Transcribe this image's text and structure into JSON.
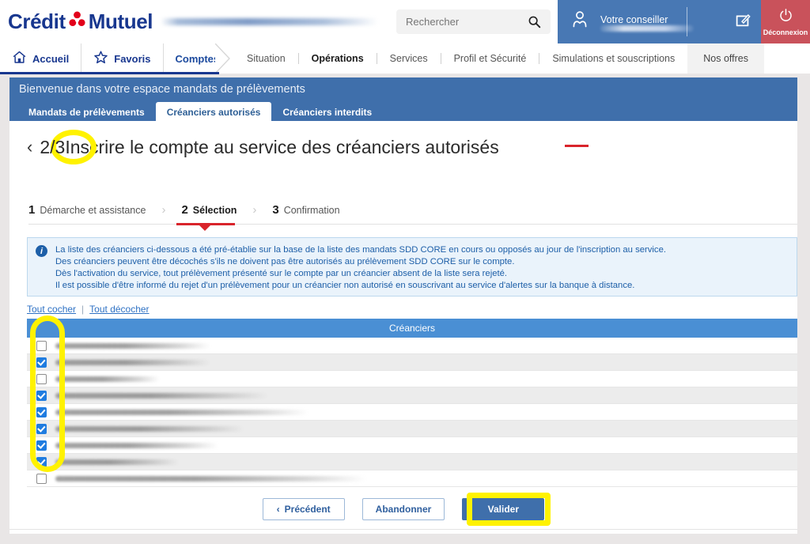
{
  "header": {
    "logo_text_1": "Crédit",
    "logo_text_2": "Mutuel",
    "logo_icon": "trefoil-icon",
    "search": {
      "placeholder": "Rechercher",
      "icon": "search-icon"
    },
    "advisor": {
      "label": "Votre conseiller",
      "icon": "person-icon"
    },
    "edit_icon": "edit-square-icon",
    "logout": {
      "label": "Déconnexion",
      "icon": "power-icon"
    }
  },
  "nav": {
    "primary": [
      {
        "label": "Accueil",
        "icon": "home-icon"
      },
      {
        "label": "Favoris",
        "icon": "star-icon"
      },
      {
        "label": "Comptes",
        "icon": ""
      }
    ],
    "secondary": [
      {
        "label": "Situation",
        "active": false
      },
      {
        "label": "Opérations",
        "active": true
      },
      {
        "label": "Services",
        "active": false
      },
      {
        "label": "Profil et Sécurité",
        "active": false
      },
      {
        "label": "Simulations et souscriptions",
        "active": false
      },
      {
        "label": "Nos offres",
        "active": false
      }
    ]
  },
  "banner": {
    "title": "Bienvenue dans votre espace mandats de prélèvements",
    "tabs": [
      {
        "label": "Mandats de prélèvements",
        "active": false
      },
      {
        "label": "Créanciers autorisés",
        "active": true
      },
      {
        "label": "Créanciers interdits",
        "active": false
      }
    ]
  },
  "page": {
    "back_icon": "chevron-left-icon",
    "step_fraction": "2/3",
    "title": "Inscrire le compte au service des créanciers autorisés"
  },
  "stepper": {
    "steps": [
      {
        "num": "1",
        "label": "Démarche et assistance",
        "active": false
      },
      {
        "num": "2",
        "label": "Sélection",
        "active": true
      },
      {
        "num": "3",
        "label": "Confirmation",
        "active": false
      }
    ],
    "separator": "›"
  },
  "info": {
    "icon": "info-icon",
    "lines": [
      "La liste des créanciers ci-dessous a été pré-établie sur la base de la liste des mandats SDD CORE en cours ou opposés au jour de l'inscription au service.",
      "Des créanciers peuvent être décochés s'ils ne doivent pas être autorisés au prélèvement SDD CORE sur le compte.",
      "Dès l'activation du service, tout prélèvement présenté sur le compte par un créancier absent de la liste sera rejeté.",
      "Il est possible d'être informé du rejet d'un prélèvement pour un créancier non autorisé en souscrivant au service d'alertes sur la banque à distance."
    ]
  },
  "bulk_actions": {
    "check_all": "Tout cocher",
    "separator": "|",
    "uncheck_all": "Tout décocher"
  },
  "table": {
    "column_header": "Créanciers",
    "rows": [
      {
        "checked": false,
        "name_width": 196
      },
      {
        "checked": true,
        "name_width": 196
      },
      {
        "checked": false,
        "name_width": 132
      },
      {
        "checked": true,
        "name_width": 269
      },
      {
        "checked": true,
        "name_width": 320
      },
      {
        "checked": true,
        "name_width": 238
      },
      {
        "checked": true,
        "name_width": 206
      },
      {
        "checked": true,
        "name_width": 156
      },
      {
        "checked": false,
        "name_width": 393
      }
    ]
  },
  "footer": {
    "previous": "Précédent",
    "previous_icon": "chevron-left-icon",
    "abandon": "Abandonner",
    "validate": "Valider"
  },
  "annotations": {
    "highlight_color": "#fff200",
    "oval_target": "step-fraction",
    "column_target": "checkbox-column",
    "rect_target": "validate-button"
  },
  "colors": {
    "brand_blue": "#18378f",
    "banner_blue": "#3f6fab",
    "table_header_blue": "#4a8fd4",
    "accent_red": "#d9242b",
    "logout_red": "#c9525b",
    "info_blue": "#1d5fa8"
  }
}
